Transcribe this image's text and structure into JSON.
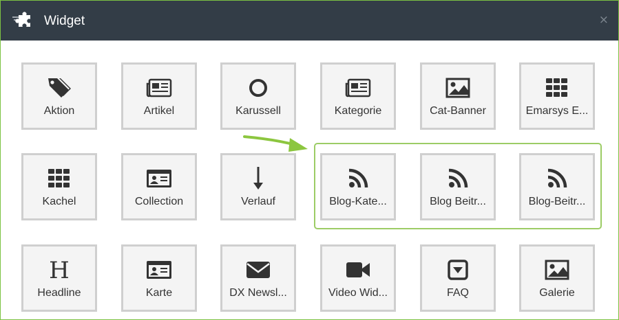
{
  "dialog": {
    "title": "Widget",
    "close_glyph": "×",
    "header_bg": "#333d47",
    "frame_border": "#7cc242",
    "highlight_color": "#9ccc65"
  },
  "rows": [
    [
      {
        "label": "Aktion",
        "icon": "tag-icon"
      },
      {
        "label": "Artikel",
        "icon": "newspaper-icon"
      },
      {
        "label": "Karussell",
        "icon": "circle-icon"
      },
      {
        "label": "Kategorie",
        "icon": "newspaper-icon"
      },
      {
        "label": "Cat-Banner",
        "icon": "image-icon"
      },
      {
        "label": "Emarsys E...",
        "icon": "grid-icon"
      }
    ],
    [
      {
        "label": "Kachel",
        "icon": "grid-icon"
      },
      {
        "label": "Collection",
        "icon": "id-card-icon"
      },
      {
        "label": "Verlauf",
        "icon": "arrow-down-icon"
      },
      {
        "label": "Blog-Kate...",
        "icon": "rss-icon"
      },
      {
        "label": "Blog Beitr...",
        "icon": "rss-icon"
      },
      {
        "label": "Blog-Beitr...",
        "icon": "rss-icon"
      }
    ],
    [
      {
        "label": "Headline",
        "icon": "heading-icon"
      },
      {
        "label": "Karte",
        "icon": "id-card-icon"
      },
      {
        "label": "DX Newsl...",
        "icon": "envelope-icon"
      },
      {
        "label": "Video Wid...",
        "icon": "video-camera-icon"
      },
      {
        "label": "FAQ",
        "icon": "caret-square-down-icon"
      },
      {
        "label": "Galerie",
        "icon": "image-icon"
      }
    ]
  ]
}
